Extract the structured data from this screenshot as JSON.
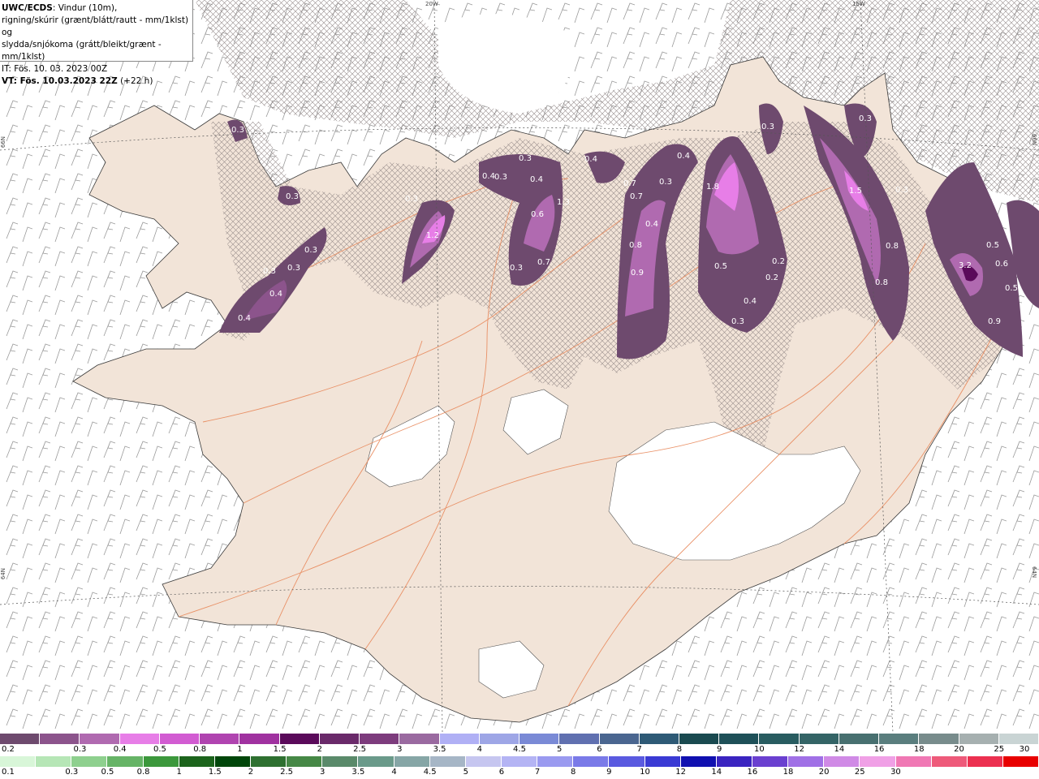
{
  "header": {
    "line1_bold": "UWC/ECDS",
    "line1_rest": ": Vindur (10m),",
    "line2": "rigning/skúrir (grænt/blátt/rautt - mm/1klst) og",
    "line3": "slydda/snjókoma (grátt/bleikt/grænt - mm/1klst)",
    "line4": "IT: Fös. 10. 03. 2023 00Z",
    "line5_bold": "VT: Fös. 10.03.2023 22Z",
    "line5_rest": " (+22 h)"
  },
  "grid_labels": {
    "lon_20w": "20W",
    "lon_15w": "15W",
    "lat_66n_left": "66N",
    "lat_66n_right": "66N",
    "lat_64n_left": "64N",
    "lat_64n_right": "64N"
  },
  "precip_values": [
    {
      "label": "0.3"
    },
    {
      "label": "0.3"
    },
    {
      "label": "0.3"
    },
    {
      "label": "0.4"
    },
    {
      "label": "0.3"
    },
    {
      "label": "0.4"
    },
    {
      "label": "0.3"
    },
    {
      "label": "1.2"
    },
    {
      "label": "0.3"
    },
    {
      "label": "0.4"
    },
    {
      "label": "0.3"
    },
    {
      "label": "0.4"
    },
    {
      "label": "0.3"
    },
    {
      "label": "1.3"
    },
    {
      "label": "0.6"
    },
    {
      "label": "0.3"
    },
    {
      "label": "0.7"
    },
    {
      "label": "0.4"
    },
    {
      "label": "0.7"
    },
    {
      "label": "0.7"
    },
    {
      "label": "0.4"
    },
    {
      "label": "0.3"
    },
    {
      "label": "0.8"
    },
    {
      "label": "0.9"
    },
    {
      "label": "0.4"
    },
    {
      "label": "0.3"
    },
    {
      "label": "1.8"
    },
    {
      "label": "0.5"
    },
    {
      "label": "0.2"
    },
    {
      "label": "0.2"
    },
    {
      "label": "0.4"
    },
    {
      "label": "0.3"
    },
    {
      "label": "0.3"
    },
    {
      "label": "1.5"
    },
    {
      "label": "0.3"
    },
    {
      "label": "0.8"
    },
    {
      "label": "0.8"
    },
    {
      "label": "3.2"
    },
    {
      "label": "0.5"
    },
    {
      "label": "0.6"
    },
    {
      "label": "0.5"
    },
    {
      "label": "0.9"
    }
  ],
  "legend_snow": {
    "colors": [
      "#6e4a6e",
      "#8c548c",
      "#b06ab0",
      "#e77ee7",
      "#d25cd2",
      "#b044b0",
      "#a032a0",
      "#5a0a5a",
      "#6a2a6a",
      "#7d3c7d",
      "#9a6aa0",
      "#b0b0f5",
      "#9ea6e6",
      "#7a8ad6",
      "#6070b0",
      "#4a6690",
      "#2e5a76",
      "#1a4a50",
      "#1e5058",
      "#285c60",
      "#346466",
      "#487070",
      "#5a7e7e",
      "#788c8c",
      "#a6b0b0",
      "#c9d4d4"
    ],
    "ticks": [
      "0.2",
      "0.3",
      "0.4",
      "0.5",
      "0.8",
      "1",
      "1.5",
      "2",
      "2.5",
      "3",
      "3.5",
      "4",
      "4.5",
      "5",
      "6",
      "7",
      "8",
      "9",
      "10",
      "12",
      "14",
      "16",
      "18",
      "20",
      "25",
      "30"
    ]
  },
  "legend_rain": {
    "colors": [
      "#d8f6d8",
      "#b6e6b6",
      "#8ed08e",
      "#66b466",
      "#3c983c",
      "#1c641c",
      "#00460a",
      "#2e7030",
      "#468846",
      "#5a8a6a",
      "#6a9a8a",
      "#86a6a6",
      "#a6b6c6",
      "#c6c6f0",
      "#b4b4f4",
      "#9a9af0",
      "#7a7ae8",
      "#5a5ae0",
      "#3a3ad4",
      "#1010b0",
      "#3a24c0",
      "#6a40d0",
      "#a070e6",
      "#d08ae6",
      "#f0a0e6",
      "#f078b4",
      "#ee5a7a",
      "#ec3050",
      "#e80000"
    ],
    "ticks": [
      "0.1",
      "0.3",
      "0.5",
      "0.8",
      "1",
      "1.5",
      "2",
      "2.5",
      "3",
      "3.5",
      "4",
      "4.5",
      "5",
      "6",
      "7",
      "8",
      "9",
      "10",
      "12",
      "14",
      "16",
      "18",
      "20",
      "25",
      "30"
    ]
  }
}
